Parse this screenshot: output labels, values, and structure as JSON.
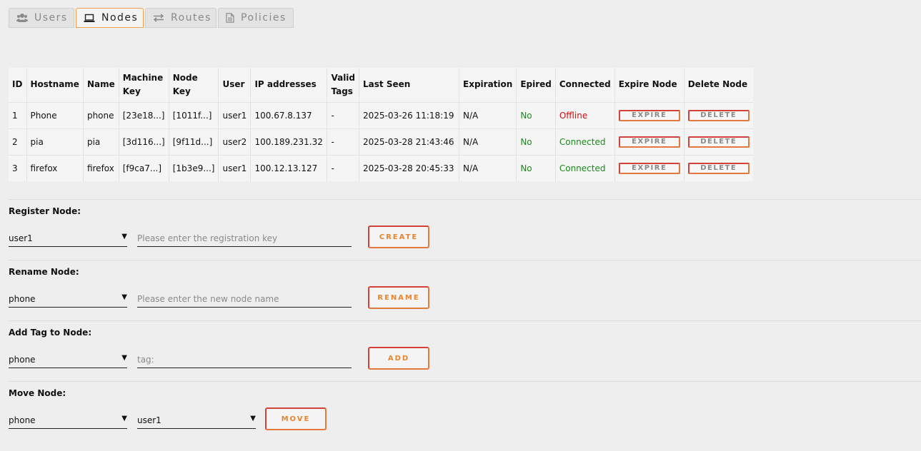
{
  "tabs": [
    {
      "label": "Users",
      "icon": "users-icon"
    },
    {
      "label": "Nodes",
      "icon": "laptop-icon"
    },
    {
      "label": "Routes",
      "icon": "exchange-icon"
    },
    {
      "label": "Policies",
      "icon": "document-icon"
    }
  ],
  "active_tab": "Nodes",
  "colors": {
    "accent": "#f0a24f",
    "button_border": "#e27a3e",
    "offline": "#d01010",
    "online": "#1a8a1a"
  },
  "table": {
    "headers": [
      "ID",
      "Hostname",
      "Name",
      "Machine Key",
      "Node Key",
      "User",
      "IP addresses",
      "Valid Tags",
      "Last Seen",
      "Expiration",
      "Epired",
      "Connected",
      "Expire Node",
      "Delete Node"
    ],
    "header_lines": [
      [
        "ID"
      ],
      [
        "Hostname"
      ],
      [
        "Name"
      ],
      [
        "Machine",
        "Key"
      ],
      [
        "Node Key"
      ],
      [
        "User"
      ],
      [
        "IP addresses"
      ],
      [
        "Valid",
        "Tags"
      ],
      [
        "Last Seen"
      ],
      [
        "Expiration"
      ],
      [
        "Epired"
      ],
      [
        "Connected"
      ],
      [
        "Expire Node"
      ],
      [
        "Delete Node"
      ]
    ],
    "rows": [
      {
        "id": "1",
        "hostname": "Phone",
        "name": "phone",
        "machine_key": "[23e18...]",
        "node_key": "[1011f...]",
        "user": "user1",
        "ip": "100.67.8.137",
        "tags": "-",
        "last_seen": "2025-03-26 11:18:19",
        "expiration": "N/A",
        "expired": "No",
        "connected": "Offline",
        "expire_label": "EXPIRE",
        "delete_label": "DELETE"
      },
      {
        "id": "2",
        "hostname": "pia",
        "name": "pia",
        "machine_key": "[3d116...]",
        "node_key": "[9f11d...]",
        "user": "user2",
        "ip": "100.189.231.32",
        "tags": "-",
        "last_seen": "2025-03-28 21:43:46",
        "expiration": "N/A",
        "expired": "No",
        "connected": "Connected",
        "expire_label": "EXPIRE",
        "delete_label": "DELETE"
      },
      {
        "id": "3",
        "hostname": "firefox",
        "name": "firefox",
        "machine_key": "[f9ca7...]",
        "node_key": "[1b3e9...]",
        "user": "user1",
        "ip": "100.12.13.127",
        "tags": "-",
        "last_seen": "2025-03-28 20:45:33",
        "expiration": "N/A",
        "expired": "No",
        "connected": "Connected",
        "expire_label": "EXPIRE",
        "delete_label": "DELETE"
      }
    ]
  },
  "forms": {
    "register": {
      "label": "Register Node:",
      "select_value": "user1",
      "input_placeholder": "Please enter the registration key",
      "button": "CREATE"
    },
    "rename": {
      "label": "Rename Node:",
      "select_value": "phone",
      "input_placeholder": "Please enter the new node name",
      "button": "RENAME"
    },
    "add_tag": {
      "label": "Add Tag to Node:",
      "select_value": "phone",
      "input_placeholder": "tag:",
      "button": "ADD"
    },
    "move": {
      "label": "Move Node:",
      "select_value": "phone",
      "select2_value": "user1",
      "button": "MOVE"
    }
  }
}
